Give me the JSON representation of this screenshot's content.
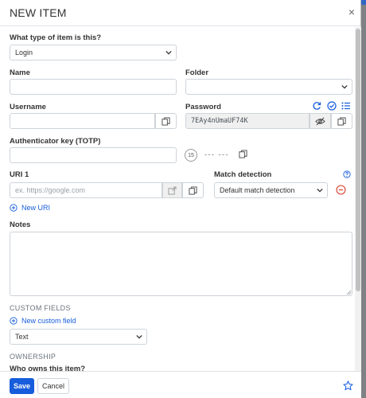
{
  "modal": {
    "title": "NEW ITEM",
    "close_glyph": "×"
  },
  "form": {
    "type_label": "What type of item is this?",
    "type_value": "Login",
    "name_label": "Name",
    "name_value": "",
    "folder_label": "Folder",
    "folder_value": "",
    "username_label": "Username",
    "username_value": "",
    "password_label": "Password",
    "password_value": "7EAy4nUmaUF74K",
    "totp_label": "Authenticator key (TOTP)",
    "totp_value": "",
    "totp_countdown": "15",
    "totp_code": "--- ---",
    "uri_label": "URI 1",
    "uri_placeholder": "ex. https://google.com",
    "match_label": "Match detection",
    "match_value": "Default match detection",
    "new_uri_label": "New URI",
    "notes_label": "Notes",
    "notes_value": ""
  },
  "custom_fields": {
    "section_title": "CUSTOM FIELDS",
    "new_field_label": "New custom field",
    "type_value": "Text"
  },
  "ownership": {
    "section_title": "OWNERSHIP",
    "question": "Who owns this item?"
  },
  "footer": {
    "save_label": "Save",
    "cancel_label": "Cancel"
  },
  "colors": {
    "accent": "#175ddc",
    "danger": "#dd4b39"
  },
  "icons": [
    "close-icon",
    "chevron-down-icon",
    "clone-icon",
    "generate-icon",
    "check-circle-icon",
    "list-icon",
    "eye-slash-icon",
    "timer-icon",
    "launch-icon",
    "help-icon",
    "remove-icon",
    "plus-circle-icon",
    "star-icon"
  ]
}
